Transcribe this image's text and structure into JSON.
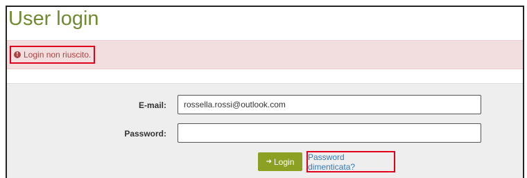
{
  "page": {
    "title": "User login"
  },
  "alert": {
    "icon": "exclamation-circle-icon",
    "message": "Login non riuscito."
  },
  "form": {
    "email_label": "E-mail:",
    "email_value": "rossella.rossi@outlook.com",
    "password_label": "Password:",
    "password_value": "",
    "login_button_icon": "sign-in-icon",
    "login_button_label": "Login",
    "forgot_password_link": "Password dimenticata?"
  },
  "colors": {
    "title": "#6e8b2f",
    "alert_background": "#f2dede",
    "alert_text": "#a94442",
    "highlight_border": "#e0001b",
    "login_button": "#8ca023",
    "link": "#337ab7",
    "form_background": "#eeeeee"
  }
}
